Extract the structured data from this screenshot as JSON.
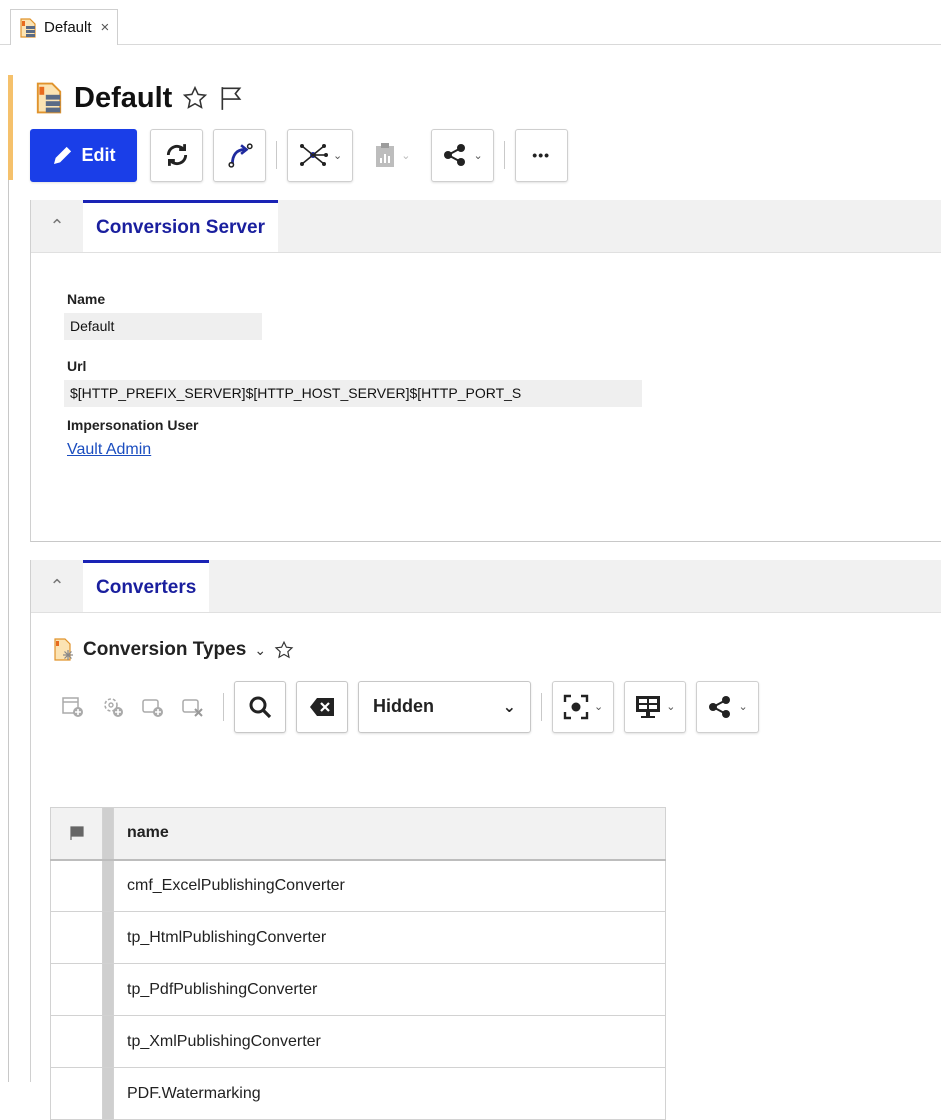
{
  "tab": {
    "label": "Default",
    "close": "×"
  },
  "header": {
    "title": "Default"
  },
  "toolbar": {
    "edit_label": "Edit",
    "more": "•••"
  },
  "panel_server": {
    "tab_label": "Conversion Server",
    "fields": {
      "name_label": "Name",
      "name_value": "Default",
      "url_label": "Url",
      "url_value": "$[HTTP_PREFIX_SERVER]$[HTTP_HOST_SERVER]$[HTTP_PORT_S",
      "user_label": "Impersonation User",
      "user_value": "Vault Admin"
    }
  },
  "panel_converters": {
    "tab_label": "Converters",
    "list_title": "Conversion Types",
    "filter": {
      "selected": "Hidden"
    },
    "table": {
      "header": "name",
      "rows": [
        "cmf_ExcelPublishingConverter",
        "tp_HtmlPublishingConverter",
        "tp_PdfPublishingConverter",
        "tp_XmlPublishingConverter",
        "PDF.Watermarking"
      ]
    }
  },
  "colors": {
    "accent_blue": "#1a3ee8",
    "tab_blue": "#1a1f9e",
    "link": "#1a4dbf",
    "side_accent": "#f5c16c"
  }
}
